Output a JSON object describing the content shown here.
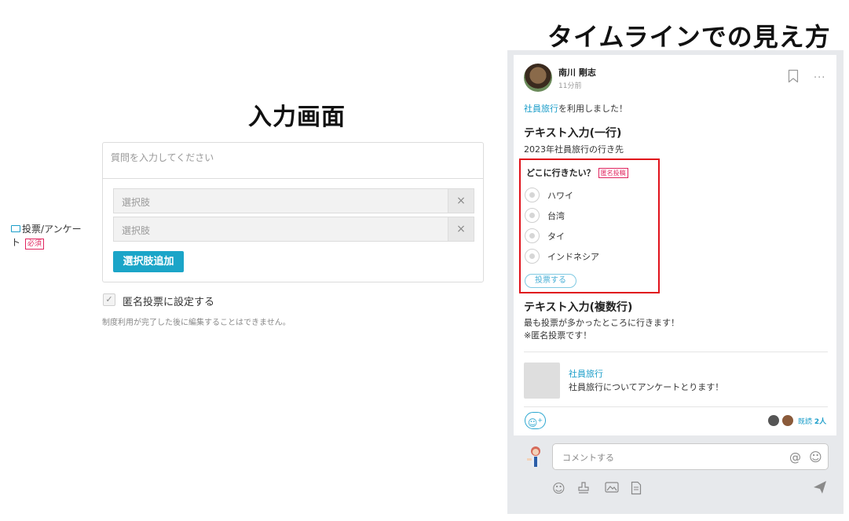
{
  "input_screen": {
    "title": "入力画面",
    "field_label": "投票/アンケート",
    "required_badge": "必須",
    "question_placeholder": "質問を入力してください",
    "choices": [
      {
        "placeholder": "選択肢",
        "remove_label": "×"
      },
      {
        "placeholder": "選択肢",
        "remove_label": "×"
      }
    ],
    "add_choice_label": "選択肢追加",
    "anonymous_checkbox": {
      "checked": true,
      "label": "匿名投票に設定する"
    },
    "note": "制度利用が完了した後に編集することはできません。"
  },
  "timeline": {
    "title": "タイムラインでの見え方",
    "post": {
      "author": "南川 剛志",
      "time": "11分前",
      "used_link": "社員旅行",
      "used_suffix": "を利用しました！",
      "section1_heading": "テキスト入力(一行)",
      "section1_text": "2023年社員旅行の行き先",
      "poll": {
        "question": "どこに行きたい？",
        "anonymous_badge": "匿名投稿",
        "options": [
          "ハワイ",
          "台湾",
          "タイ",
          "インドネシア"
        ],
        "vote_label": "投票する",
        "highlight_color": "#e0121b"
      },
      "section2_heading": "テキスト入力(複数行)",
      "section2_lines": [
        "最も投票が多かったところに行きます！",
        "※匿名投票です！"
      ],
      "group": {
        "name": "社員旅行",
        "description": "社員旅行についてアンケートとります！"
      },
      "read_label": "既読",
      "read_count": "2人"
    },
    "comment": {
      "placeholder": "コメントする",
      "icons": [
        "at-icon",
        "smile-icon"
      ]
    },
    "toolbar_icons": [
      "emoji-icon",
      "stamp-icon",
      "image-icon",
      "file-icon",
      "send-icon"
    ]
  },
  "colors": {
    "accent": "#1ba5c8",
    "link": "#1a9dc9",
    "required": "#e0245e"
  }
}
